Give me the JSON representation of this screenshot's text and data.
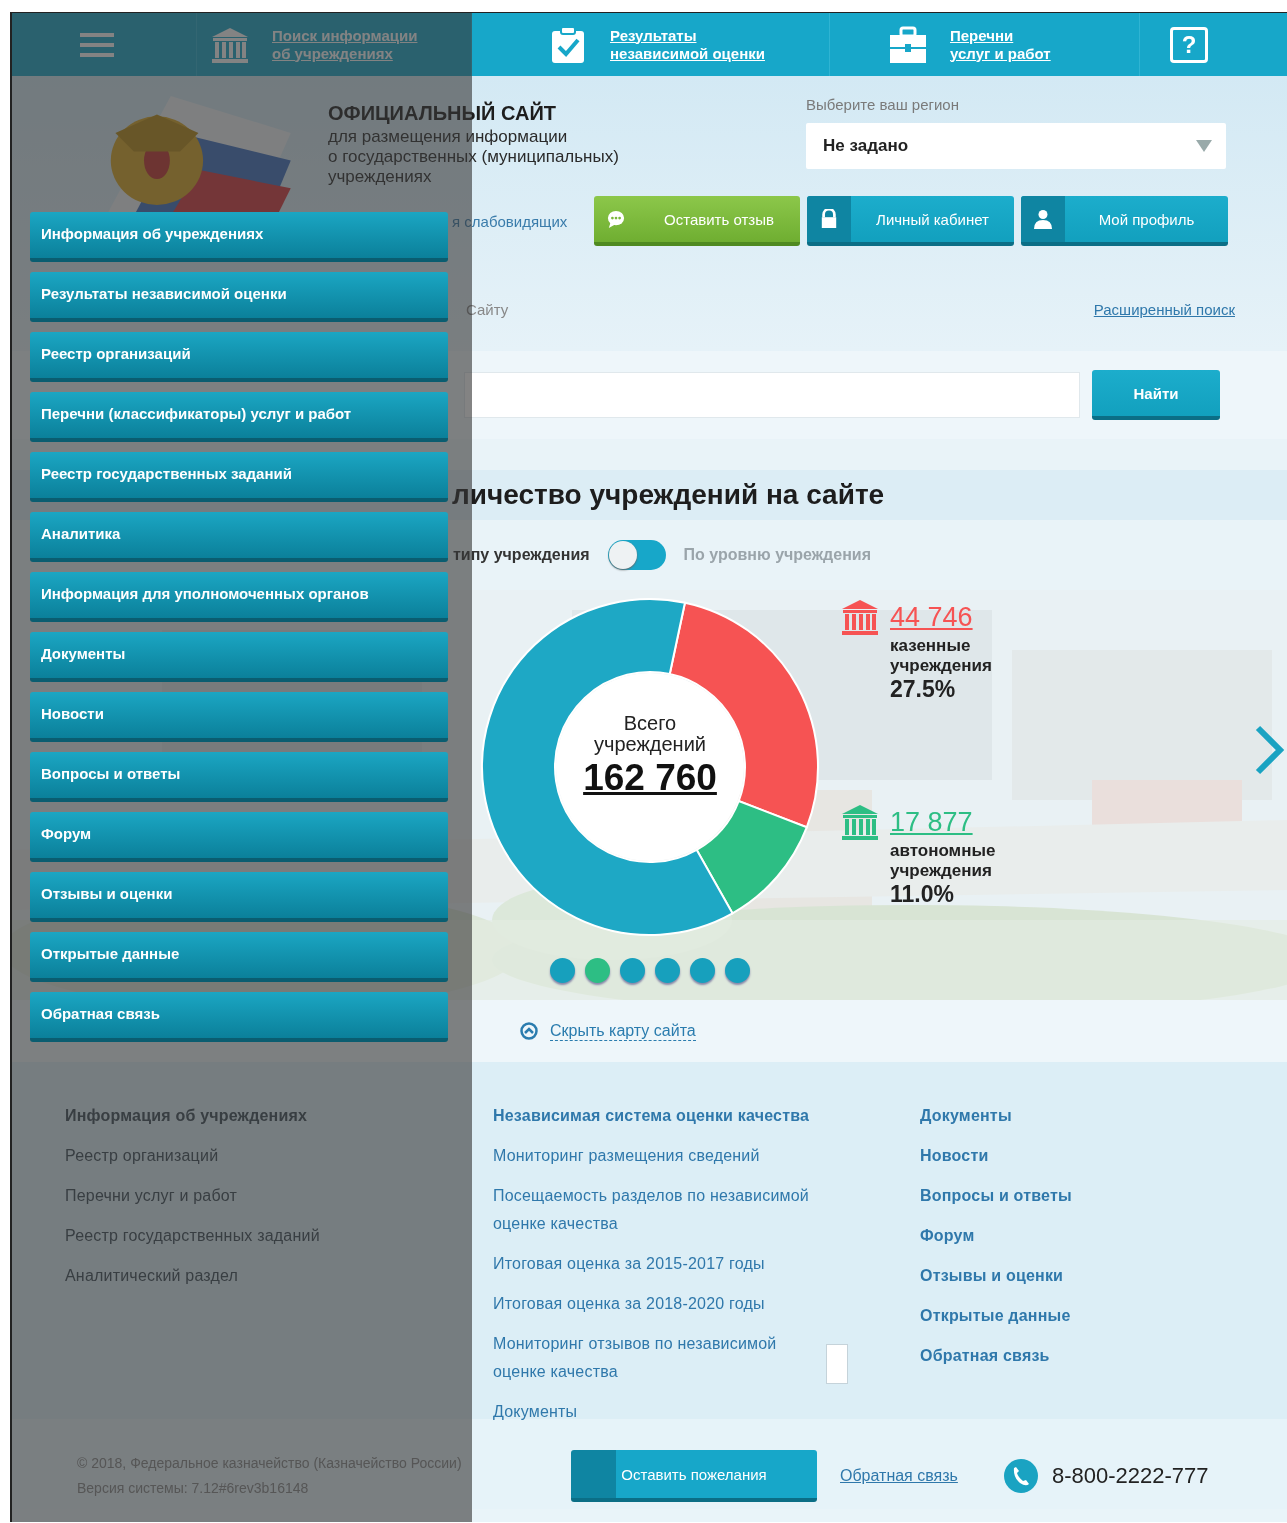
{
  "top_nav": {
    "items": [
      {
        "kind": "menu",
        "expanded": true
      },
      {
        "kind": "link",
        "label_lines": [
          "Поиск информации",
          "об учреждениях"
        ]
      },
      {
        "kind": "link",
        "label_lines": [
          "Результаты",
          "независимой оценки"
        ]
      },
      {
        "kind": "link",
        "label_lines": [
          "Перечни",
          "услуг и работ"
        ]
      },
      {
        "kind": "help",
        "glyph": "?"
      }
    ]
  },
  "header": {
    "title": "ОФИЦИАЛЬНЫЙ САЙТ",
    "subtitle_lines": [
      "для размещения информации",
      "о государственных (муниципальных)",
      "учреждениях"
    ],
    "region": {
      "label": "Выберите ваш регион",
      "value": "Не задано"
    },
    "accessibility_link": "я слабовидящих",
    "buttons": [
      {
        "kind": "feedback",
        "label": "Оставить отзыв"
      },
      {
        "kind": "cabinet",
        "label": "Личный кабинет"
      },
      {
        "kind": "profile",
        "label": "Мой профиль"
      }
    ],
    "search_label": "Сайту",
    "advanced_search": "Расширенный поиск",
    "search_button": "Найти"
  },
  "stats": {
    "title": "личество учреждений на сайте",
    "toggle": {
      "left": "типу учреждения",
      "right": "По уровню учреждения",
      "on": false
    },
    "total": {
      "label": "Всего учреждений",
      "value": "162 760"
    },
    "chart_data": {
      "type": "donut",
      "values": [
        27.5,
        11.0,
        61.5
      ],
      "colors": [
        "#f65353",
        "#2dbe84",
        "#1ea8c5"
      ]
    },
    "legend": [
      {
        "value": "44 746",
        "label": "казенные учреждения",
        "percent": "27.5%",
        "color": "#f65353"
      },
      {
        "value": "17 877",
        "label": "автономные учреждения",
        "percent": "11.0%",
        "color": "#2dbe84"
      }
    ],
    "dots": [
      {
        "selected": false
      },
      {
        "selected": true
      },
      {
        "selected": false
      },
      {
        "selected": false
      },
      {
        "selected": false
      },
      {
        "selected": false
      }
    ]
  },
  "sitemap_toggle": "Скрыть карту сайта",
  "sitemap": {
    "columns": [
      [
        "Информация об учреждениях",
        "Реестр организаций",
        "Перечни услуг и работ",
        "Реестр государственных заданий",
        "Аналитический раздел"
      ],
      [
        "Независимая система оценки качества",
        "Мониторинг размещения сведений",
        "Посещаемость разделов по независимой оценке качества",
        "Итоговая оценка за 2015-2017 годы",
        "Итоговая оценка за 2018-2020 годы",
        "Мониторинг отзывов по независимой оценке качества",
        "Документы"
      ],
      [
        "Документы",
        "Новости",
        "Вопросы и ответы",
        "Форум",
        "Отзывы и оценки",
        "Открытые данные",
        "Обратная связь"
      ]
    ]
  },
  "footer": {
    "copyright": "© 2018, Федеральное казначейство (Казначейство России)",
    "version": "Версия системы: 7.12#6rev3b16148",
    "button": "Оставить пожелания",
    "link": "Обратная связь",
    "phone": "8-800-2222-777"
  },
  "drawer": {
    "items": [
      "Информация об учреждениях",
      "Результаты независимой оценки",
      "Реестр организаций",
      "Перечни (классификаторы) услуг и работ",
      "Реестр государственных заданий",
      "Аналитика",
      "Информация для уполномоченных органов",
      "Документы",
      "Новости",
      "Вопросы и ответы",
      "Форум",
      "Отзывы и оценки",
      "Открытые данные",
      "Обратная связь"
    ]
  }
}
